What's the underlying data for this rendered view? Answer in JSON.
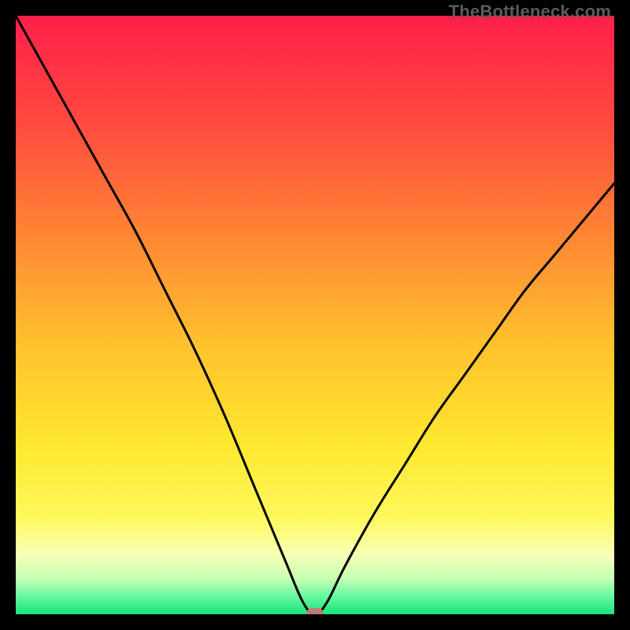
{
  "watermark": "TheBottleneck.com",
  "colors": {
    "border": "#000000",
    "curve": "#000000",
    "marker": "#bf7a76",
    "gradient_stops": [
      {
        "pct": 0,
        "color": "#ff1f4a"
      },
      {
        "pct": 18,
        "color": "#ff4a3f"
      },
      {
        "pct": 38,
        "color": "#ff8a33"
      },
      {
        "pct": 55,
        "color": "#ffc22e"
      },
      {
        "pct": 72,
        "color": "#ffe82f"
      },
      {
        "pct": 84,
        "color": "#fff85e"
      },
      {
        "pct": 90,
        "color": "#f8ffb6"
      },
      {
        "pct": 94,
        "color": "#c7ffb5"
      },
      {
        "pct": 97,
        "color": "#68f7a0"
      },
      {
        "pct": 100,
        "color": "#17e37a"
      }
    ]
  },
  "chart_data": {
    "type": "line",
    "title": "",
    "xlabel": "",
    "ylabel": "",
    "xlim": [
      0,
      100
    ],
    "ylim": [
      0,
      100
    ],
    "x": [
      0,
      5,
      10,
      15,
      20,
      25,
      30,
      35,
      40,
      45,
      48,
      50,
      52,
      55,
      60,
      65,
      70,
      75,
      80,
      85,
      90,
      95,
      100
    ],
    "values": [
      100,
      91,
      82,
      73,
      64,
      54,
      44,
      33,
      21,
      9,
      2,
      0,
      2,
      8,
      17,
      25,
      33,
      40,
      47,
      54,
      60,
      66,
      72
    ],
    "marker": {
      "x": 50,
      "y": 0
    },
    "notes": "Approximate V-shaped bottleneck curve read from the figure; y=0 at the optimum around x≈50, rising to 100 at x=0 and about 72 at x=100."
  }
}
